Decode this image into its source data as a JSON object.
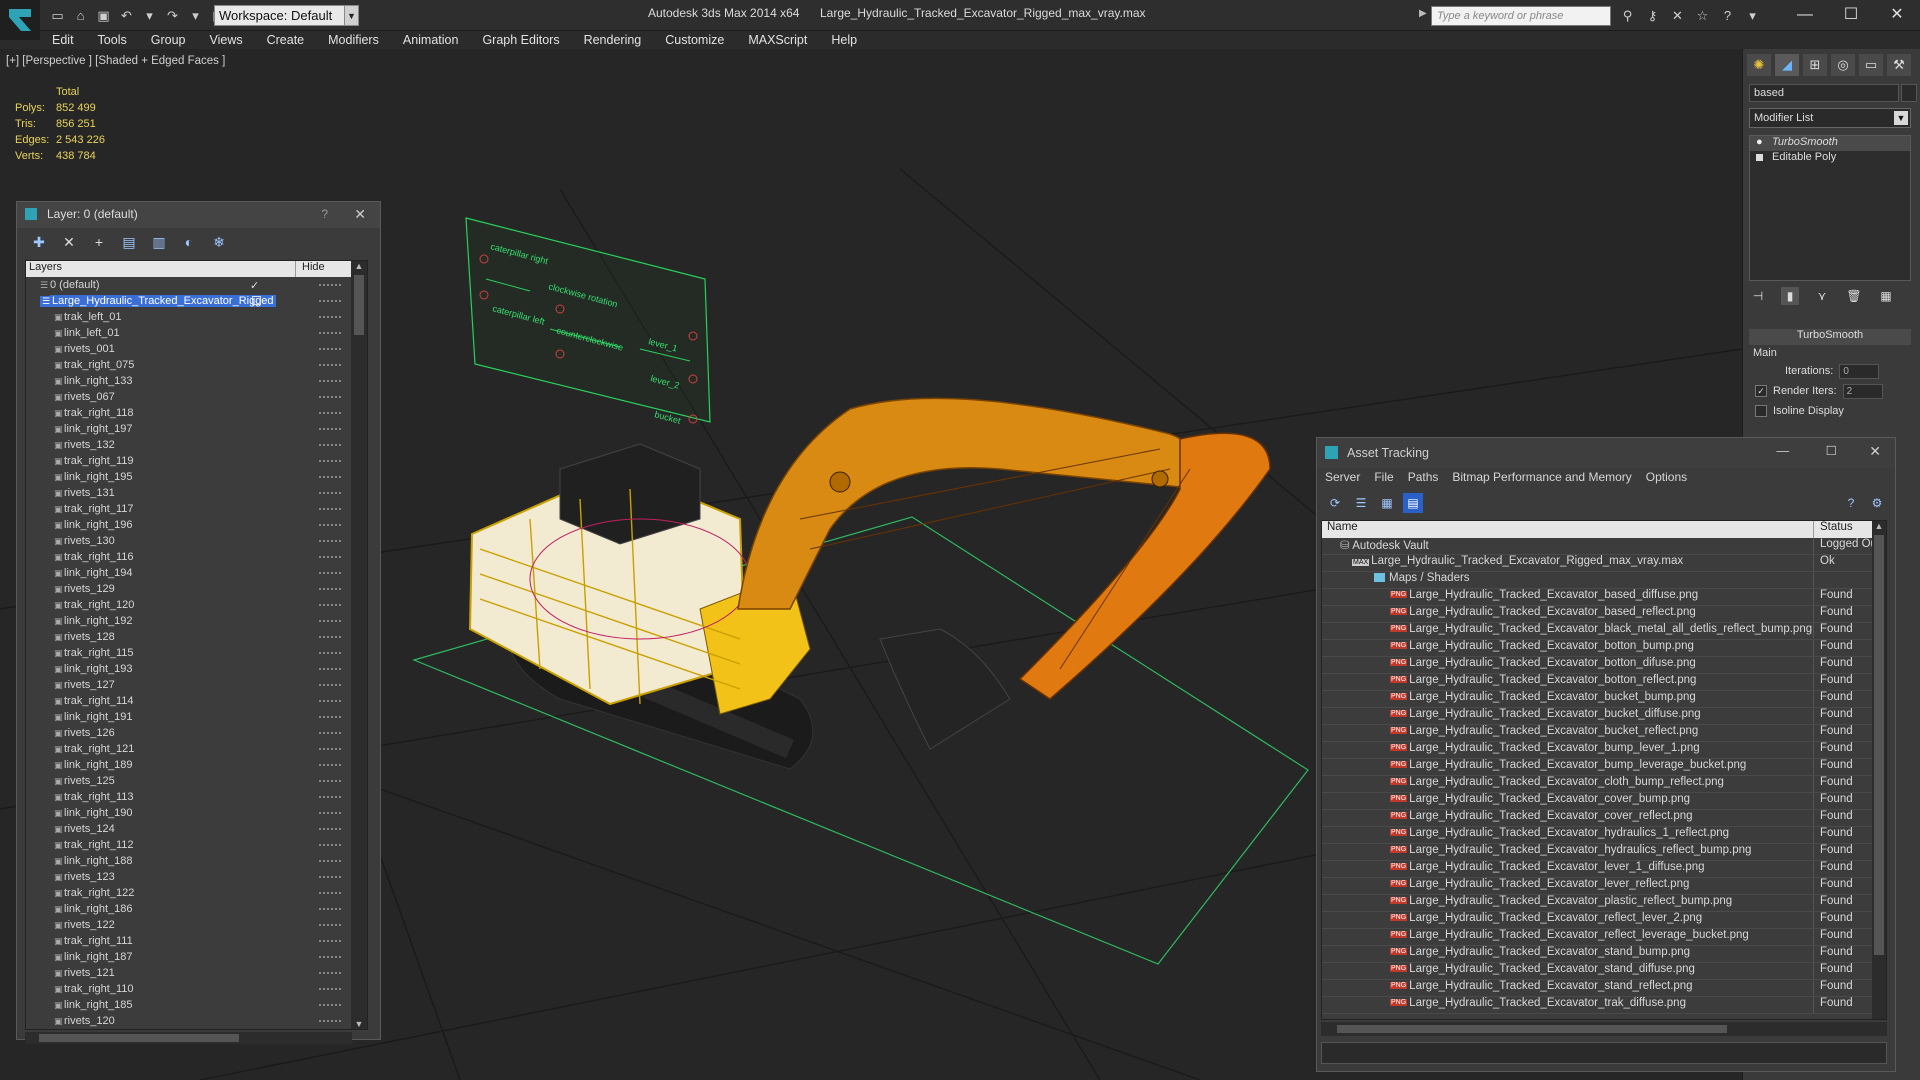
{
  "app": {
    "title": "Autodesk 3ds Max  2014 x64",
    "file": "Large_Hydraulic_Tracked_Excavator_Rigged_max_vray.max",
    "workspace": "Workspace: Default",
    "search_placeholder": "Type a keyword or phrase"
  },
  "menu": [
    "Edit",
    "Tools",
    "Group",
    "Views",
    "Create",
    "Modifiers",
    "Animation",
    "Graph Editors",
    "Rendering",
    "Customize",
    "MAXScript",
    "Help"
  ],
  "viewport": {
    "label": "[+] [Perspective ] [Shaded + Edged Faces ]",
    "stats": {
      "header": "Total",
      "rows": [
        {
          "k": "Polys:",
          "v": "852 499"
        },
        {
          "k": "Tris:",
          "v": "856 251"
        },
        {
          "k": "Edges:",
          "v": "2 543 226"
        },
        {
          "k": "Verts:",
          "v": "438 784"
        }
      ]
    }
  },
  "layer_dialog": {
    "title": "Layer: 0 (default)",
    "col_layers": "Layers",
    "col_hide": "Hide",
    "rows": [
      "0 (default)",
      "Large_Hydraulic_Tracked_Excavator_Rigged",
      "trak_left_01",
      "link_left_01",
      "rivets_001",
      "trak_right_075",
      "link_right_133",
      "rivets_067",
      "trak_right_118",
      "link_right_197",
      "rivets_132",
      "trak_right_119",
      "link_right_195",
      "rivets_131",
      "trak_right_117",
      "link_right_196",
      "rivets_130",
      "trak_right_116",
      "link_right_194",
      "rivets_129",
      "trak_right_120",
      "link_right_192",
      "rivets_128",
      "trak_right_115",
      "link_right_193",
      "rivets_127",
      "trak_right_114",
      "link_right_191",
      "rivets_126",
      "trak_right_121",
      "link_right_189",
      "rivets_125",
      "trak_right_113",
      "link_right_190",
      "rivets_124",
      "trak_right_112",
      "link_right_188",
      "rivets_123",
      "trak_right_122",
      "link_right_186",
      "rivets_122",
      "trak_right_111",
      "link_right_187",
      "rivets_121",
      "trak_right_110",
      "link_right_185",
      "rivets_120"
    ]
  },
  "cmd_panel": {
    "object_name": "based",
    "modifier_list": "Modifier List",
    "stack": [
      "TurboSmooth",
      "Editable Poly"
    ],
    "rollout_title": "TurboSmooth",
    "main_label": "Main",
    "iterations_label": "Iterations:",
    "iterations_value": "0",
    "render_iters_label": "Render Iters:",
    "render_iters_value": "2",
    "isoline_label": "Isoline Display"
  },
  "asset_dialog": {
    "title": "Asset Tracking",
    "menu": [
      "Server",
      "File",
      "Paths",
      "Bitmap Performance and Memory",
      "Options"
    ],
    "col_name": "Name",
    "col_status": "Status",
    "vault": {
      "name": "Autodesk Vault",
      "status": "Logged Ou"
    },
    "maxfile": {
      "name": "Large_Hydraulic_Tracked_Excavator_Rigged_max_vray.max",
      "status": "Ok"
    },
    "folder": "Maps / Shaders",
    "files": [
      "Large_Hydraulic_Tracked_Excavator_based_diffuse.png",
      "Large_Hydraulic_Tracked_Excavator_based_reflect.png",
      "Large_Hydraulic_Tracked_Excavator_black_metal_all_detlis_reflect_bump.png",
      "Large_Hydraulic_Tracked_Excavator_botton_bump.png",
      "Large_Hydraulic_Tracked_Excavator_botton_difuse.png",
      "Large_Hydraulic_Tracked_Excavator_botton_reflect.png",
      "Large_Hydraulic_Tracked_Excavator_bucket_bump.png",
      "Large_Hydraulic_Tracked_Excavator_bucket_diffuse.png",
      "Large_Hydraulic_Tracked_Excavator_bucket_reflect.png",
      "Large_Hydraulic_Tracked_Excavator_bump_lever_1.png",
      "Large_Hydraulic_Tracked_Excavator_bump_leverage_bucket.png",
      "Large_Hydraulic_Tracked_Excavator_cloth_bump_reflect.png",
      "Large_Hydraulic_Tracked_Excavator_cover_bump.png",
      "Large_Hydraulic_Tracked_Excavator_cover_reflect.png",
      "Large_Hydraulic_Tracked_Excavator_hydraulics_1_reflect.png",
      "Large_Hydraulic_Tracked_Excavator_hydraulics_reflect_bump.png",
      "Large_Hydraulic_Tracked_Excavator_lever_1_diffuse.png",
      "Large_Hydraulic_Tracked_Excavator_lever_reflect.png",
      "Large_Hydraulic_Tracked_Excavator_plastic_reflect_bump.png",
      "Large_Hydraulic_Tracked_Excavator_reflect_lever_2.png",
      "Large_Hydraulic_Tracked_Excavator_reflect_leverage_bucket.png",
      "Large_Hydraulic_Tracked_Excavator_stand_bump.png",
      "Large_Hydraulic_Tracked_Excavator_stand_diffuse.png",
      "Large_Hydraulic_Tracked_Excavator_stand_reflect.png",
      "Large_Hydraulic_Tracked_Excavator_trak_diffuse.png"
    ],
    "file_status": "Found"
  }
}
